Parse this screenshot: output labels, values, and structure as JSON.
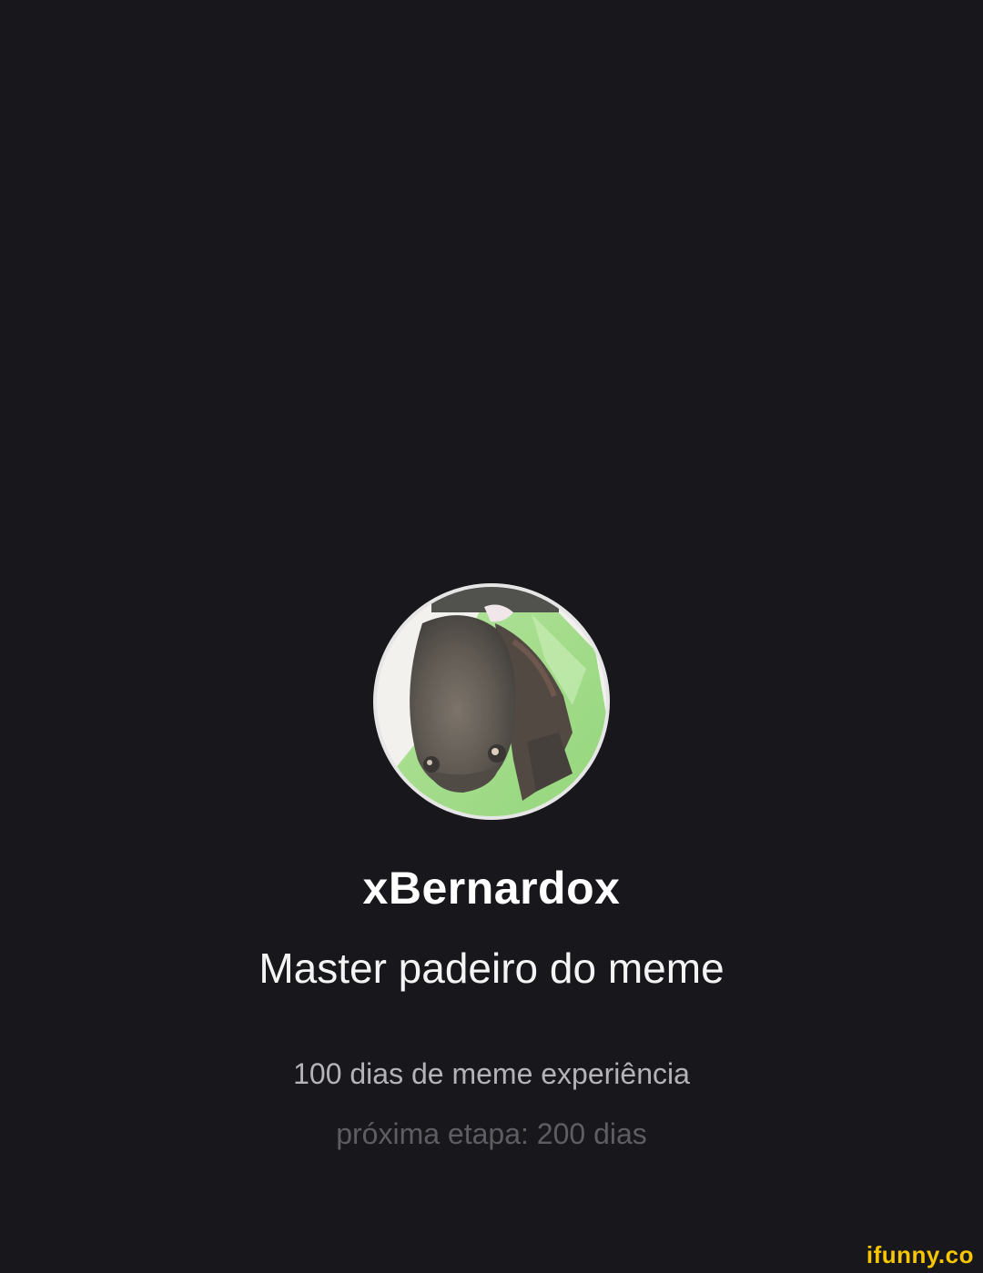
{
  "profile": {
    "username": "xBernardox",
    "status": "Master padeiro do meme",
    "experience": "100 dias de meme experiência",
    "next_stage": "próxima etapa: 200 dias"
  },
  "watermark": {
    "text": "ifunny.co"
  },
  "colors": {
    "background": "#18181c",
    "username": "#ffffff",
    "status": "#f4f4f4",
    "experience": "#b3b3b8",
    "next_stage": "#5d5d63",
    "watermark": "#f7c600"
  }
}
